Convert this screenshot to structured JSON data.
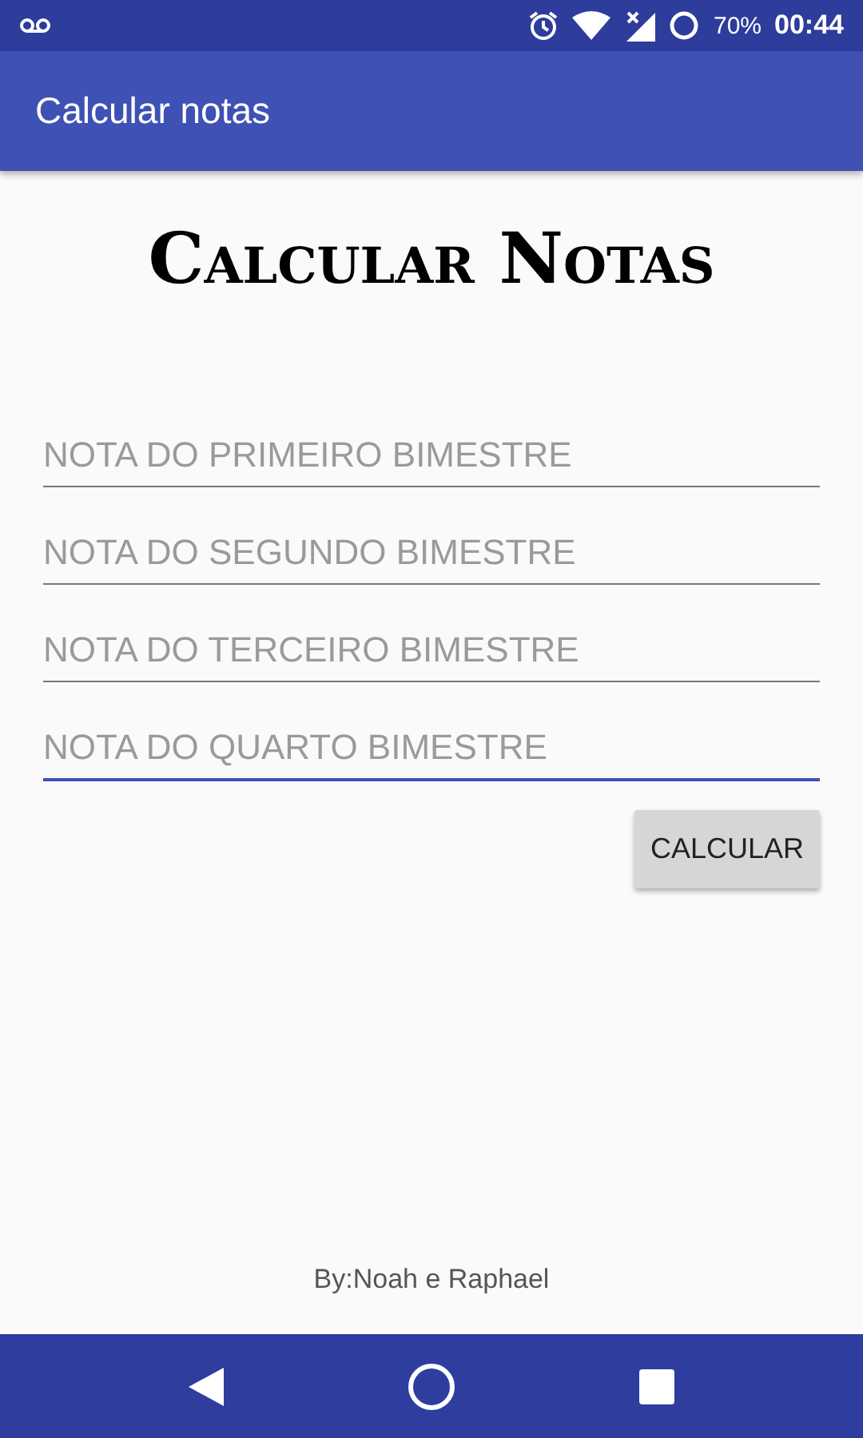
{
  "status_bar": {
    "battery": "70%",
    "time": "00:44"
  },
  "app_bar": {
    "title": "Calcular notas"
  },
  "heading": "Calcular Notas",
  "fields": [
    {
      "placeholder": "NOTA DO PRIMEIRO BIMESTRE",
      "focused": false
    },
    {
      "placeholder": "NOTA DO SEGUNDO BIMESTRE",
      "focused": false
    },
    {
      "placeholder": "NOTA DO TERCEIRO BIMESTRE",
      "focused": false
    },
    {
      "placeholder": "NOTA DO QUARTO BIMESTRE",
      "focused": true
    }
  ],
  "button": "CALCULAR",
  "footer": "By:Noah e Raphael"
}
